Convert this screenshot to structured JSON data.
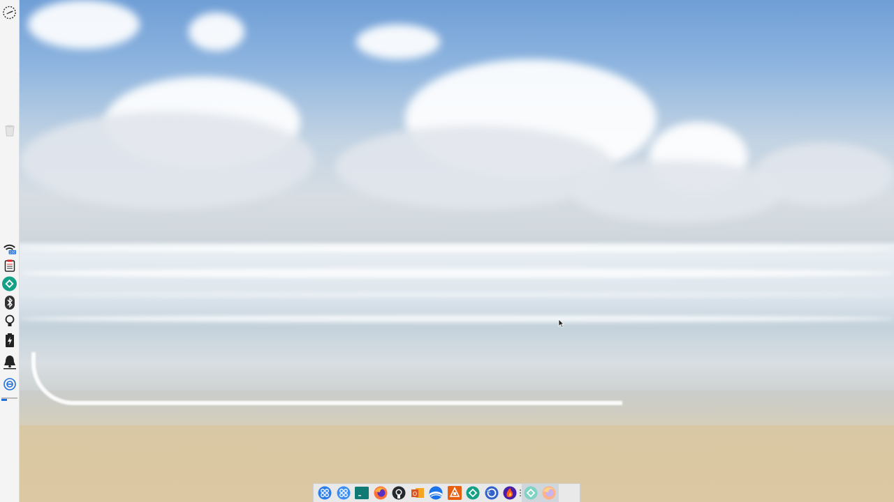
{
  "desktop": {
    "wallpaper": "beach-seascape",
    "colors": {
      "sky": "#7aa6d8",
      "sand": "#d9c7a0",
      "panel": "#f4f4f4",
      "dock": "#e9e9ea",
      "accent_green": "#14a085",
      "accent_blue": "#1e6fd9"
    }
  },
  "left_panel": {
    "top_icons": [
      {
        "name": "clock-icon"
      }
    ],
    "middle_icons": [
      {
        "name": "trash-icon"
      }
    ],
    "tray_icons": [
      {
        "name": "wifi-icon",
        "badge": "100"
      },
      {
        "name": "clipboard-icon"
      },
      {
        "name": "sync-app-icon"
      },
      {
        "name": "bluetooth-icon"
      },
      {
        "name": "lightbulb-icon"
      },
      {
        "name": "battery-icon"
      },
      {
        "name": "bell-icon"
      },
      {
        "name": "power-icon"
      }
    ]
  },
  "dock": {
    "items": [
      {
        "name": "app-grid-icon"
      },
      {
        "name": "app-grid-alt-icon"
      },
      {
        "name": "terminal-icon"
      },
      {
        "name": "firefox-icon"
      },
      {
        "name": "github-icon"
      },
      {
        "name": "outlook-icon"
      },
      {
        "name": "google-earth-icon"
      },
      {
        "name": "office-apps-icon"
      },
      {
        "name": "sync-app-icon"
      },
      {
        "name": "browser-app-icon"
      },
      {
        "name": "firefox-dev-icon"
      },
      {
        "name": "sync-app-running-icon"
      },
      {
        "name": "firefox-running-icon"
      }
    ]
  }
}
